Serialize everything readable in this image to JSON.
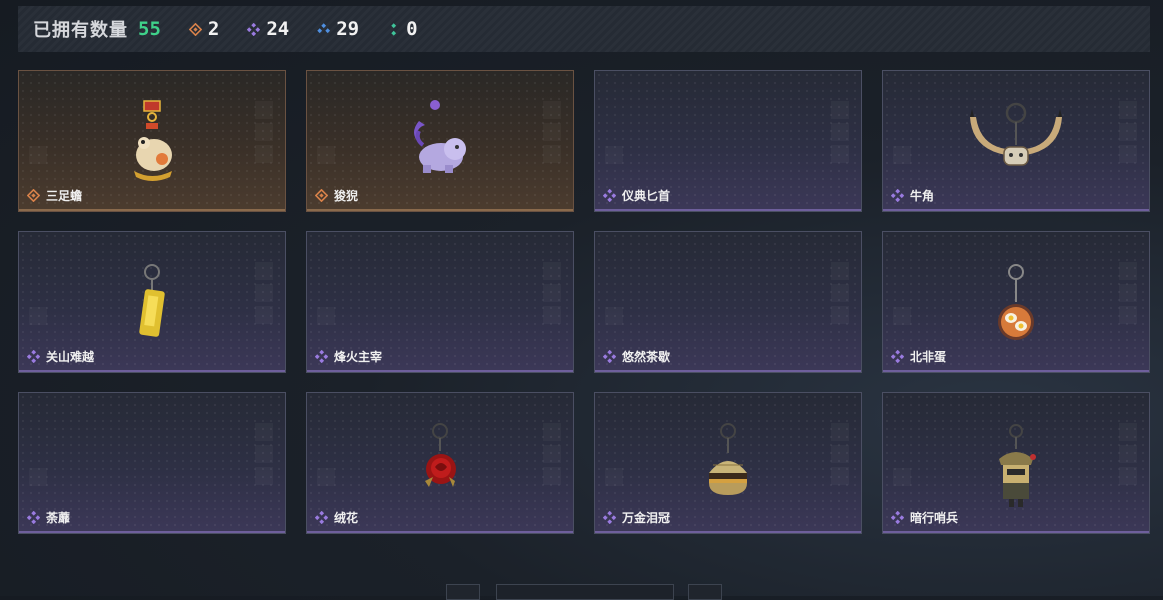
{
  "summary": {
    "owned_label": "已拥有数量",
    "owned_count": "55",
    "rarities": [
      {
        "name": "orange-rarity-icon",
        "color": "#d9824a",
        "count": "2"
      },
      {
        "name": "purple-rarity-icon",
        "color": "#9a7be0",
        "count": "24"
      },
      {
        "name": "blue-rarity-icon",
        "color": "#4f8fe0",
        "count": "29"
      },
      {
        "name": "green-rarity-icon",
        "color": "#3fc49a",
        "count": "0"
      }
    ]
  },
  "items": [
    {
      "label": "三足蟾",
      "rarity": "orange",
      "art": "toad-charm"
    },
    {
      "label": "狻猊",
      "rarity": "orange",
      "art": "lion-charm"
    },
    {
      "label": "仪典匕首",
      "rarity": "purple",
      "art": ""
    },
    {
      "label": "牛角",
      "rarity": "purple",
      "art": "horns-charm"
    },
    {
      "label": "关山难越",
      "rarity": "purple",
      "art": "gold-bar-charm"
    },
    {
      "label": "烽火主宰",
      "rarity": "purple",
      "art": ""
    },
    {
      "label": "悠然茶歇",
      "rarity": "purple",
      "art": ""
    },
    {
      "label": "北非蛋",
      "rarity": "purple",
      "art": "egg-plate-charm"
    },
    {
      "label": "荼蘼",
      "rarity": "purple",
      "art": ""
    },
    {
      "label": "绒花",
      "rarity": "purple",
      "art": "rose-charm"
    },
    {
      "label": "万金泪冠",
      "rarity": "purple",
      "art": "burger-charm"
    },
    {
      "label": "暗行哨兵",
      "rarity": "purple",
      "art": "sentinel-charm"
    }
  ],
  "colors": {
    "owned_count": "#3fd18a",
    "orange": "#d9824a",
    "purple": "#9a7be0"
  }
}
